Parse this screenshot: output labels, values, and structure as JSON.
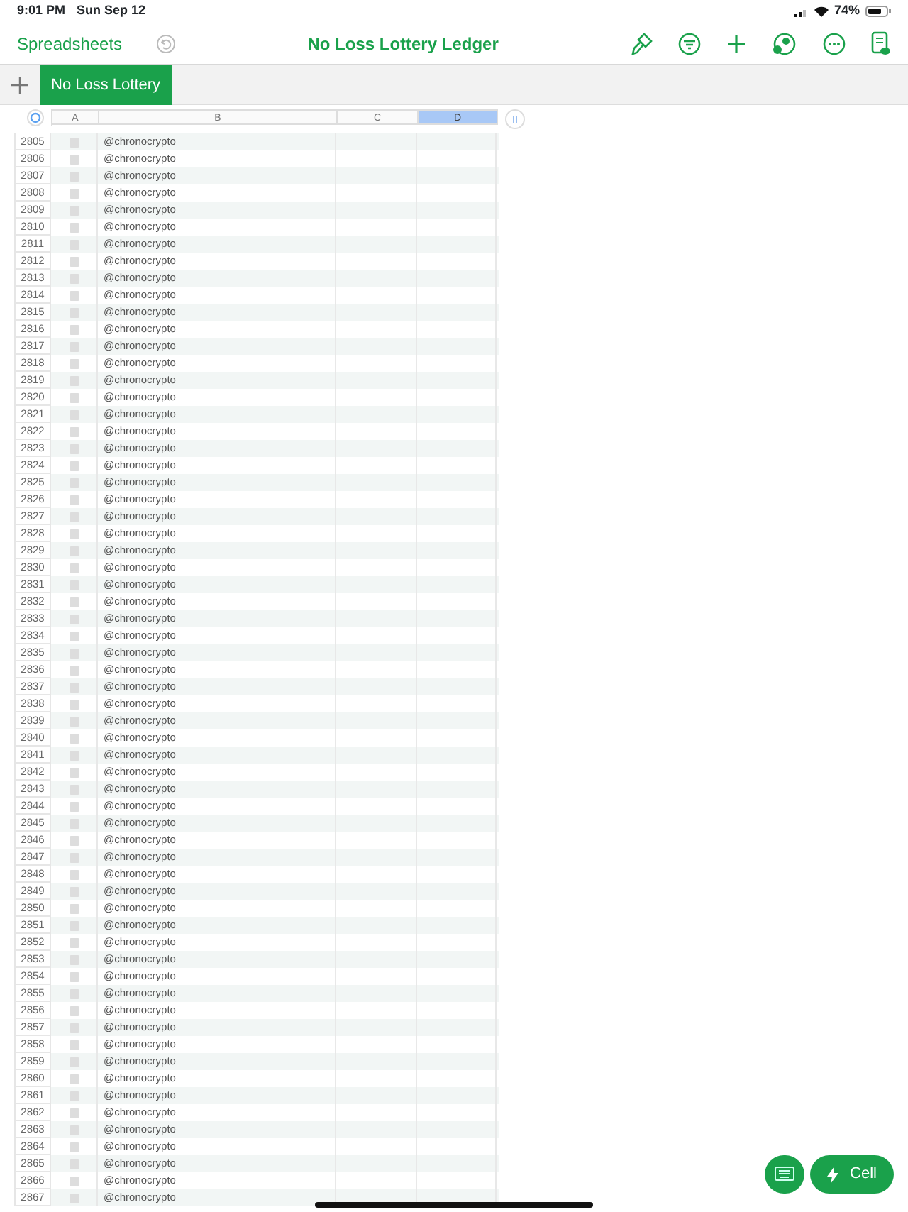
{
  "status_bar": {
    "time": "9:01 PM",
    "date": "Sun Sep 12",
    "battery": "74%"
  },
  "toolbar": {
    "back": "Spreadsheets",
    "title": "No Loss Lottery Ledger"
  },
  "sheet_tabs": [
    {
      "label": "No Loss Lottery",
      "selected": true
    }
  ],
  "columns": [
    {
      "label": "A",
      "selected": false
    },
    {
      "label": "B",
      "selected": false
    },
    {
      "label": "C",
      "selected": false
    },
    {
      "label": "D",
      "selected": true
    }
  ],
  "rows": [
    {
      "number": "2805",
      "checked": false,
      "handle": "@chronocrypto"
    },
    {
      "number": "2806",
      "checked": false,
      "handle": "@chronocrypto"
    },
    {
      "number": "2807",
      "checked": false,
      "handle": "@chronocrypto"
    },
    {
      "number": "2808",
      "checked": false,
      "handle": "@chronocrypto"
    },
    {
      "number": "2809",
      "checked": false,
      "handle": "@chronocrypto"
    },
    {
      "number": "2810",
      "checked": false,
      "handle": "@chronocrypto"
    },
    {
      "number": "2811",
      "checked": false,
      "handle": "@chronocrypto"
    },
    {
      "number": "2812",
      "checked": false,
      "handle": "@chronocrypto"
    },
    {
      "number": "2813",
      "checked": false,
      "handle": "@chronocrypto"
    },
    {
      "number": "2814",
      "checked": false,
      "handle": "@chronocrypto"
    },
    {
      "number": "2815",
      "checked": false,
      "handle": "@chronocrypto"
    },
    {
      "number": "2816",
      "checked": false,
      "handle": "@chronocrypto"
    },
    {
      "number": "2817",
      "checked": false,
      "handle": "@chronocrypto"
    },
    {
      "number": "2818",
      "checked": false,
      "handle": "@chronocrypto"
    },
    {
      "number": "2819",
      "checked": false,
      "handle": "@chronocrypto"
    },
    {
      "number": "2820",
      "checked": false,
      "handle": "@chronocrypto"
    },
    {
      "number": "2821",
      "checked": false,
      "handle": "@chronocrypto"
    },
    {
      "number": "2822",
      "checked": false,
      "handle": "@chronocrypto"
    },
    {
      "number": "2823",
      "checked": false,
      "handle": "@chronocrypto"
    },
    {
      "number": "2824",
      "checked": false,
      "handle": "@chronocrypto"
    },
    {
      "number": "2825",
      "checked": false,
      "handle": "@chronocrypto"
    },
    {
      "number": "2826",
      "checked": false,
      "handle": "@chronocrypto"
    },
    {
      "number": "2827",
      "checked": false,
      "handle": "@chronocrypto"
    },
    {
      "number": "2828",
      "checked": false,
      "handle": "@chronocrypto"
    },
    {
      "number": "2829",
      "checked": false,
      "handle": "@chronocrypto"
    },
    {
      "number": "2830",
      "checked": false,
      "handle": "@chronocrypto"
    },
    {
      "number": "2831",
      "checked": false,
      "handle": "@chronocrypto"
    },
    {
      "number": "2832",
      "checked": false,
      "handle": "@chronocrypto"
    },
    {
      "number": "2833",
      "checked": false,
      "handle": "@chronocrypto"
    },
    {
      "number": "2834",
      "checked": false,
      "handle": "@chronocrypto"
    },
    {
      "number": "2835",
      "checked": false,
      "handle": "@chronocrypto"
    },
    {
      "number": "2836",
      "checked": false,
      "handle": "@chronocrypto"
    },
    {
      "number": "2837",
      "checked": false,
      "handle": "@chronocrypto"
    },
    {
      "number": "2838",
      "checked": false,
      "handle": "@chronocrypto"
    },
    {
      "number": "2839",
      "checked": false,
      "handle": "@chronocrypto"
    },
    {
      "number": "2840",
      "checked": false,
      "handle": "@chronocrypto"
    },
    {
      "number": "2841",
      "checked": false,
      "handle": "@chronocrypto"
    },
    {
      "number": "2842",
      "checked": false,
      "handle": "@chronocrypto"
    },
    {
      "number": "2843",
      "checked": false,
      "handle": "@chronocrypto"
    },
    {
      "number": "2844",
      "checked": false,
      "handle": "@chronocrypto"
    },
    {
      "number": "2845",
      "checked": false,
      "handle": "@chronocrypto"
    },
    {
      "number": "2846",
      "checked": false,
      "handle": "@chronocrypto"
    },
    {
      "number": "2847",
      "checked": false,
      "handle": "@chronocrypto"
    },
    {
      "number": "2848",
      "checked": false,
      "handle": "@chronocrypto"
    },
    {
      "number": "2849",
      "checked": false,
      "handle": "@chronocrypto"
    },
    {
      "number": "2850",
      "checked": false,
      "handle": "@chronocrypto"
    },
    {
      "number": "2851",
      "checked": false,
      "handle": "@chronocrypto"
    },
    {
      "number": "2852",
      "checked": false,
      "handle": "@chronocrypto"
    },
    {
      "number": "2853",
      "checked": false,
      "handle": "@chronocrypto"
    },
    {
      "number": "2854",
      "checked": false,
      "handle": "@chronocrypto"
    },
    {
      "number": "2855",
      "checked": false,
      "handle": "@chronocrypto"
    },
    {
      "number": "2856",
      "checked": false,
      "handle": "@chronocrypto"
    },
    {
      "number": "2857",
      "checked": false,
      "handle": "@chronocrypto"
    },
    {
      "number": "2858",
      "checked": false,
      "handle": "@chronocrypto"
    },
    {
      "number": "2859",
      "checked": false,
      "handle": "@chronocrypto"
    },
    {
      "number": "2860",
      "checked": false,
      "handle": "@chronocrypto"
    },
    {
      "number": "2861",
      "checked": false,
      "handle": "@chronocrypto"
    },
    {
      "number": "2862",
      "checked": false,
      "handle": "@chronocrypto"
    },
    {
      "number": "2863",
      "checked": false,
      "handle": "@chronocrypto"
    },
    {
      "number": "2864",
      "checked": false,
      "handle": "@chronocrypto"
    },
    {
      "number": "2865",
      "checked": false,
      "handle": "@chronocrypto"
    },
    {
      "number": "2866",
      "checked": false,
      "handle": "@chronocrypto"
    },
    {
      "number": "2867",
      "checked": false,
      "handle": "@chronocrypto"
    }
  ],
  "action_button": {
    "label": "Cell"
  }
}
